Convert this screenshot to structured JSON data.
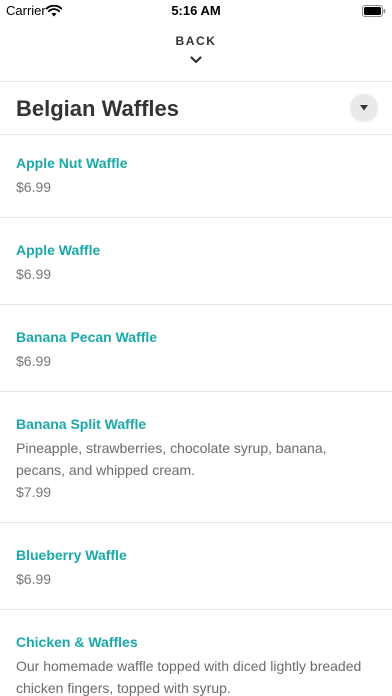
{
  "status_bar": {
    "carrier": "Carrier",
    "time": "5:16 AM",
    "wifi_icon": "wifi-icon",
    "battery_icon": "battery-icon"
  },
  "nav": {
    "back_label": "BACK",
    "back_icon": "chevron-down-icon"
  },
  "category": {
    "title": "Belgian Waffles",
    "toggle_icon": "caret-down-icon"
  },
  "items": [
    {
      "name": "Apple Nut Waffle",
      "description": "",
      "price": "$6.99"
    },
    {
      "name": "Apple Waffle",
      "description": "",
      "price": "$6.99"
    },
    {
      "name": "Banana Pecan Waffle",
      "description": "",
      "price": "$6.99"
    },
    {
      "name": "Banana Split Waffle",
      "description": "Pineapple, strawberries, chocolate syrup, banana, pecans, and whipped cream.",
      "price": "$7.99"
    },
    {
      "name": "Blueberry Waffle",
      "description": "",
      "price": "$6.99"
    },
    {
      "name": "Chicken & Waffles",
      "description": "Our homemade waffle topped with diced lightly breaded chicken fingers, topped with syrup.",
      "price": ""
    }
  ],
  "colors": {
    "accent": "#1aa8a8",
    "text": "#333333",
    "muted": "#777777",
    "divider": "#e6e6e6"
  }
}
